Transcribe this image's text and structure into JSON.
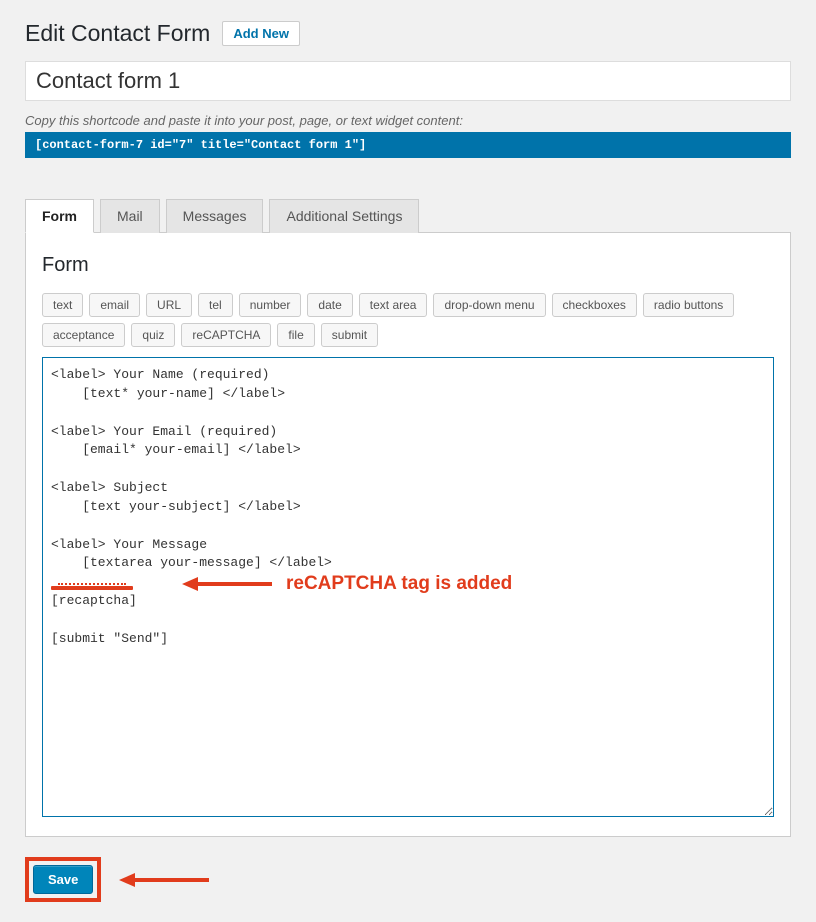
{
  "header": {
    "title": "Edit Contact Form",
    "add_new": "Add New"
  },
  "form_title": "Contact form 1",
  "helper": "Copy this shortcode and paste it into your post, page, or text widget content:",
  "shortcode": "[contact-form-7 id=\"7\" title=\"Contact form 1\"]",
  "tabs": [
    {
      "label": "Form",
      "active": true
    },
    {
      "label": "Mail",
      "active": false
    },
    {
      "label": "Messages",
      "active": false
    },
    {
      "label": "Additional Settings",
      "active": false
    }
  ],
  "panel": {
    "heading": "Form",
    "tag_buttons": [
      "text",
      "email",
      "URL",
      "tel",
      "number",
      "date",
      "text area",
      "drop-down menu",
      "checkboxes",
      "radio buttons",
      "acceptance",
      "quiz",
      "reCAPTCHA",
      "file",
      "submit"
    ],
    "code": "<label> Your Name (required)\n    [text* your-name] </label>\n\n<label> Your Email (required)\n    [email* your-email] </label>\n\n<label> Subject\n    [text your-subject] </label>\n\n<label> Your Message\n    [textarea your-message] </label>\n\n[recaptcha]\n\n[submit \"Send\"]"
  },
  "annotations": {
    "recaptcha_note": "reCAPTCHA tag is added"
  },
  "actions": {
    "save": "Save"
  }
}
